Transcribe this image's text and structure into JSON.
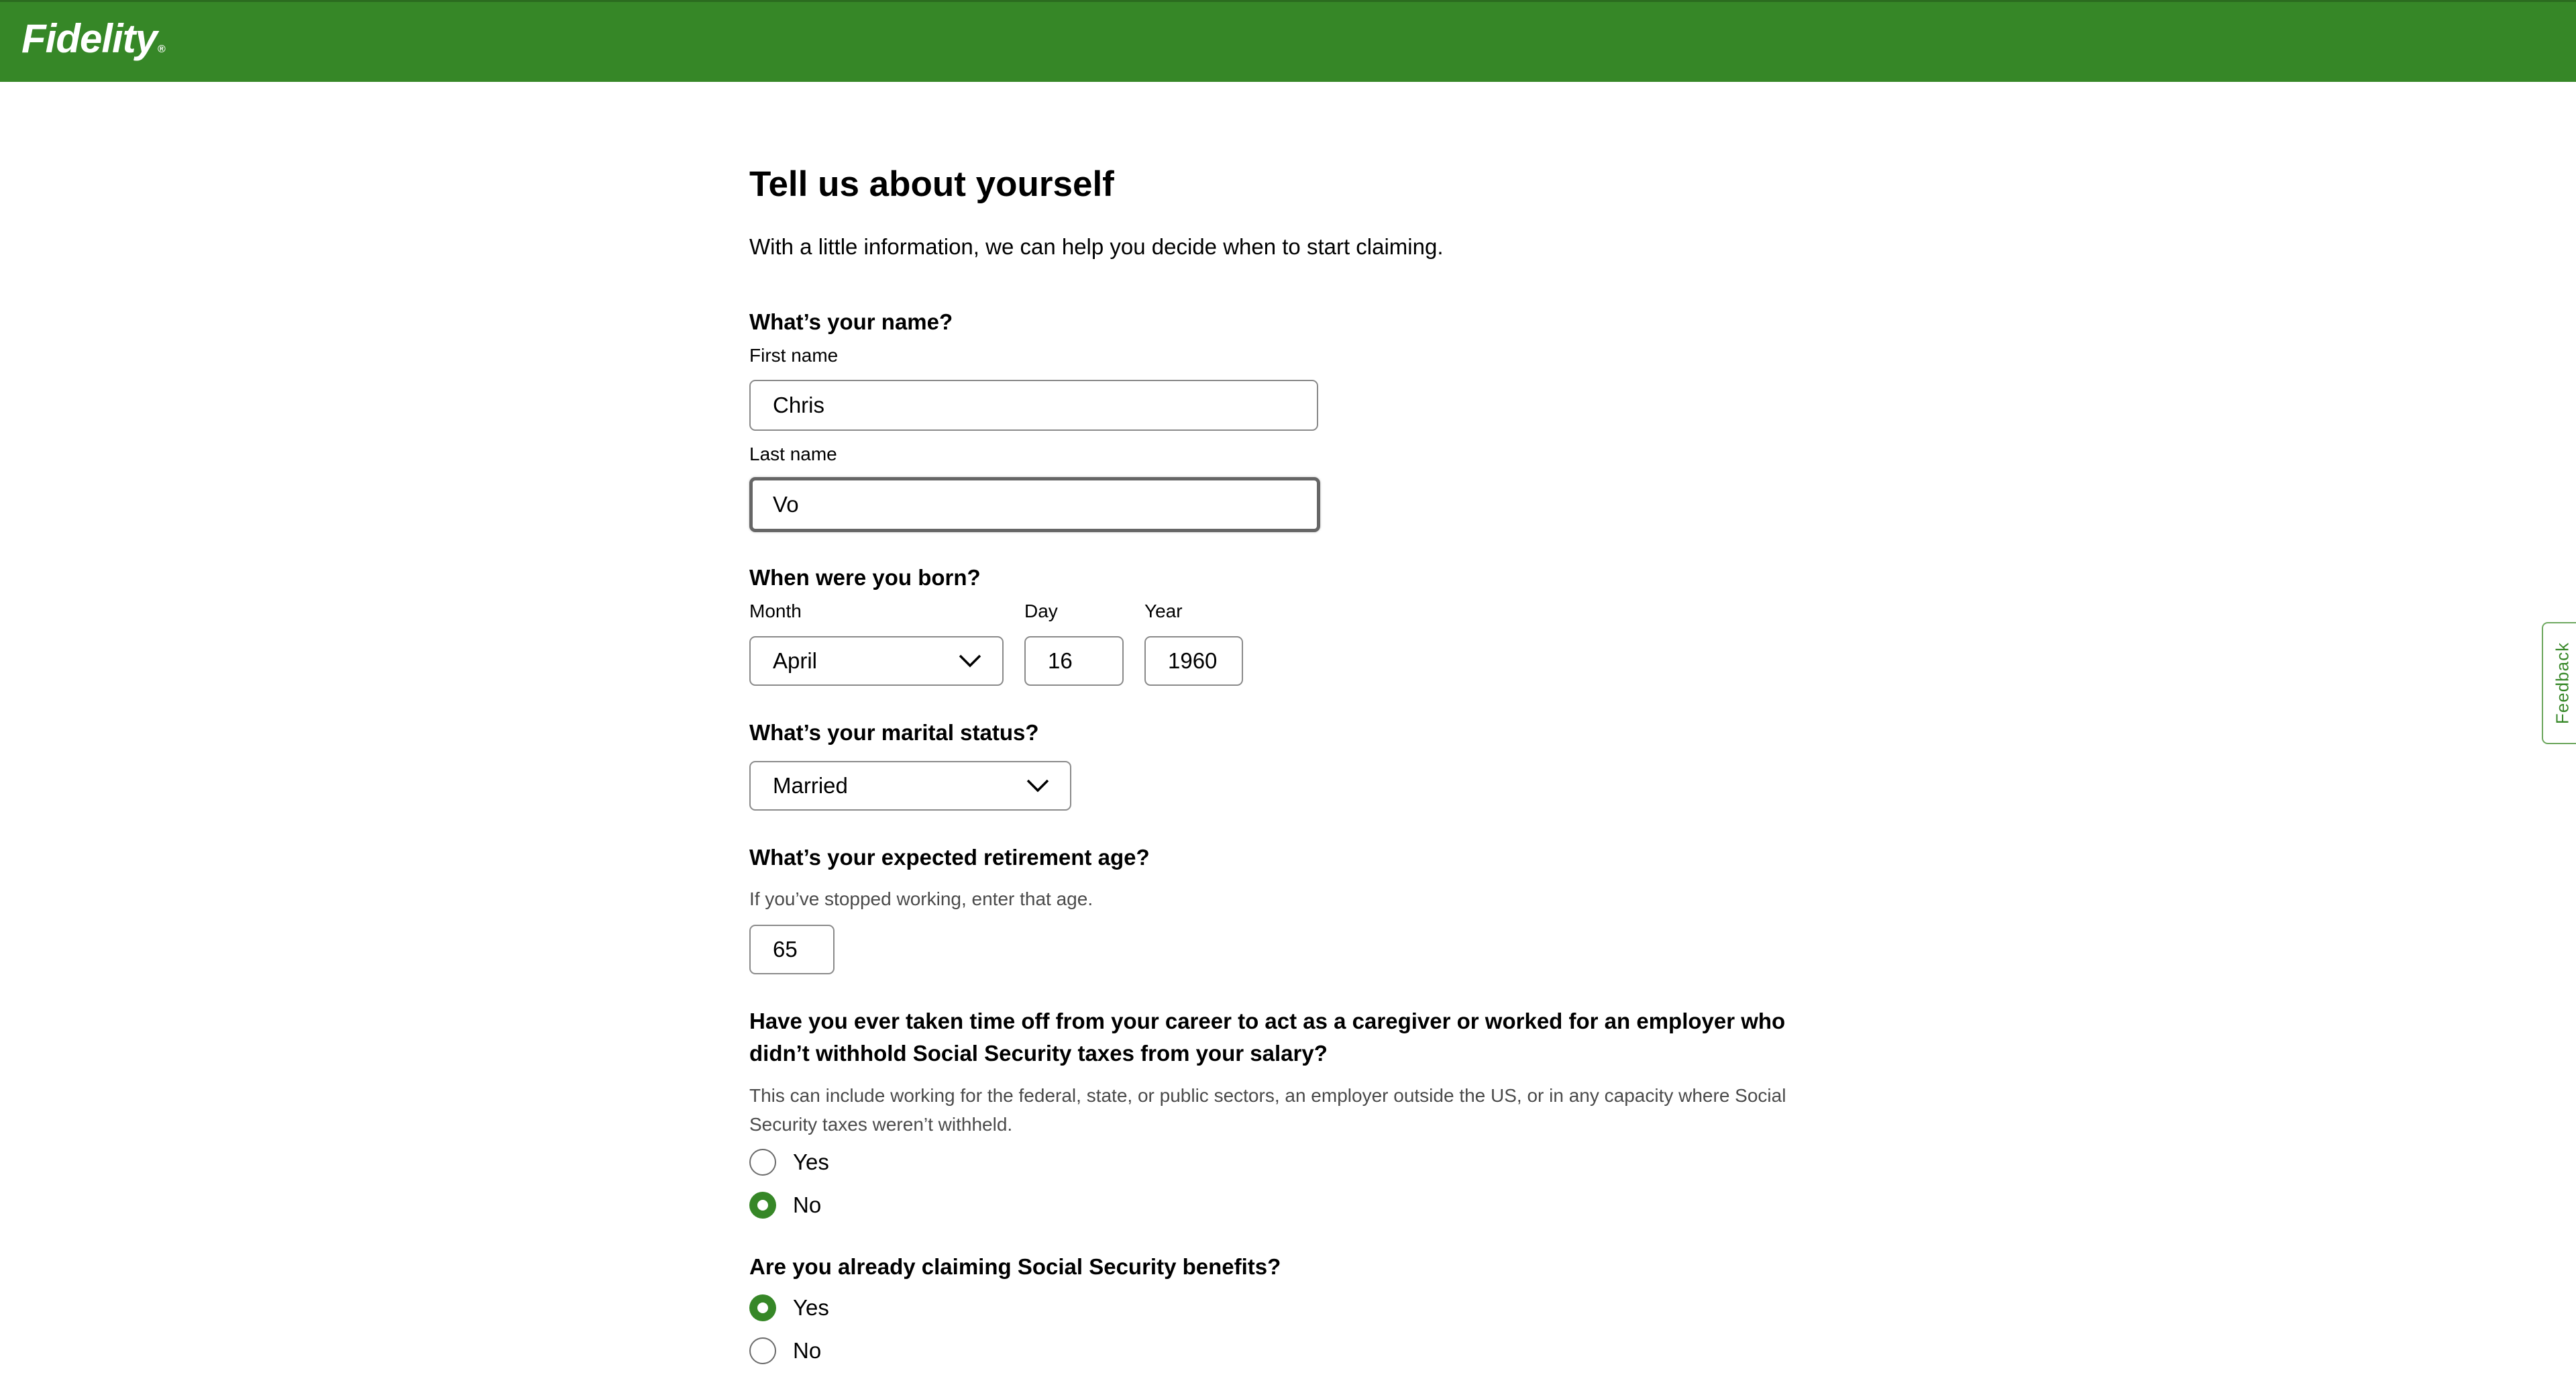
{
  "header": {
    "logo_text": "Fidelity",
    "brand_color": "#368727"
  },
  "page": {
    "title": "Tell us about yourself",
    "subtitle": "With a little information, we can help you decide when to start claiming."
  },
  "name_section": {
    "question": "What’s your name?",
    "first_name_label": "First name",
    "first_name_value": "Chris",
    "last_name_label": "Last name",
    "last_name_value": "Vo"
  },
  "birth_section": {
    "question": "When were you born?",
    "month_label": "Month",
    "month_value": "April",
    "day_label": "Day",
    "day_value": "16",
    "year_label": "Year",
    "year_value": "1960"
  },
  "marital_section": {
    "question": "What’s your marital status?",
    "value": "Married"
  },
  "retirement_section": {
    "question": "What’s your expected retirement age?",
    "hint": "If you’ve stopped working, enter that age.",
    "value": "65"
  },
  "caregiver_section": {
    "question": "Have you ever taken time off from your career to act as a caregiver or worked for an employer who didn’t withhold Social Security taxes from your salary?",
    "hint": "This can include working for the federal, state, or public sectors, an employer outside the US, or in any capacity where Social Security taxes weren’t withheld.",
    "options": [
      {
        "label": "Yes",
        "selected": false
      },
      {
        "label": "No",
        "selected": true
      }
    ]
  },
  "claiming_section": {
    "question": "Are you already claiming Social Security benefits?",
    "options": [
      {
        "label": "Yes",
        "selected": true
      },
      {
        "label": "No",
        "selected": false
      }
    ]
  },
  "feedback": {
    "label": "Feedback"
  }
}
